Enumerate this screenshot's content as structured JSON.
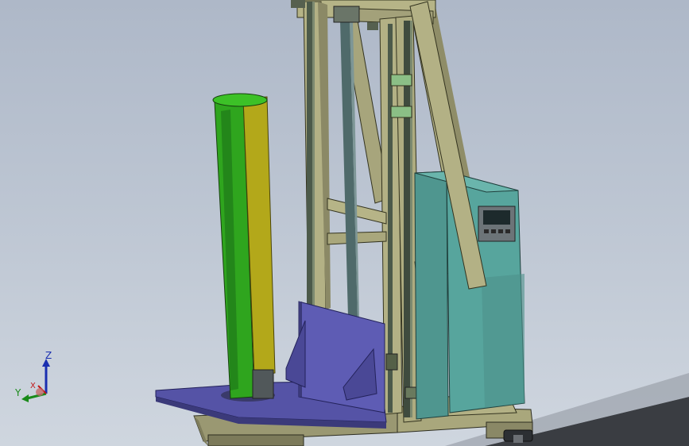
{
  "viewport": {
    "background_top": "#aeb8c8",
    "background_bottom": "#cfd6df"
  },
  "model": {
    "frame_color": "#b6b487",
    "rail_color": "#5c6a58",
    "post_green": "#2fa51e",
    "post_olive": "#b3a81a",
    "platform_color": "#5553a6",
    "cabinet_color": "#4e9c94",
    "rod_color": "#4f6a6a"
  },
  "control_panel": {
    "screen_icon": "hmi-screen-icon",
    "button_count": 4
  },
  "triad": {
    "z_label": "Z",
    "y_label": "Y",
    "x_label": "X",
    "z_color": "#1a2fb0",
    "y_color": "#1a8a1a",
    "x_color": "#c01818"
  }
}
